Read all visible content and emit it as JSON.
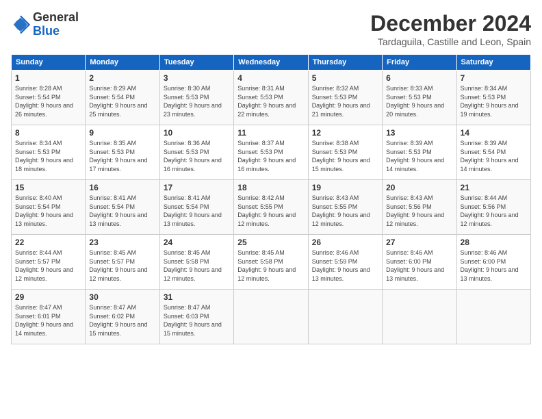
{
  "header": {
    "logo_line1": "General",
    "logo_line2": "Blue",
    "month_title": "December 2024",
    "location": "Tardaguila, Castille and Leon, Spain"
  },
  "weekdays": [
    "Sunday",
    "Monday",
    "Tuesday",
    "Wednesday",
    "Thursday",
    "Friday",
    "Saturday"
  ],
  "weeks": [
    [
      {
        "day": "1",
        "sunrise": "8:28 AM",
        "sunset": "5:54 PM",
        "daylight": "9 hours and 26 minutes."
      },
      {
        "day": "2",
        "sunrise": "8:29 AM",
        "sunset": "5:54 PM",
        "daylight": "9 hours and 25 minutes."
      },
      {
        "day": "3",
        "sunrise": "8:30 AM",
        "sunset": "5:53 PM",
        "daylight": "9 hours and 23 minutes."
      },
      {
        "day": "4",
        "sunrise": "8:31 AM",
        "sunset": "5:53 PM",
        "daylight": "9 hours and 22 minutes."
      },
      {
        "day": "5",
        "sunrise": "8:32 AM",
        "sunset": "5:53 PM",
        "daylight": "9 hours and 21 minutes."
      },
      {
        "day": "6",
        "sunrise": "8:33 AM",
        "sunset": "5:53 PM",
        "daylight": "9 hours and 20 minutes."
      },
      {
        "day": "7",
        "sunrise": "8:34 AM",
        "sunset": "5:53 PM",
        "daylight": "9 hours and 19 minutes."
      }
    ],
    [
      {
        "day": "8",
        "sunrise": "8:34 AM",
        "sunset": "5:53 PM",
        "daylight": "9 hours and 18 minutes."
      },
      {
        "day": "9",
        "sunrise": "8:35 AM",
        "sunset": "5:53 PM",
        "daylight": "9 hours and 17 minutes."
      },
      {
        "day": "10",
        "sunrise": "8:36 AM",
        "sunset": "5:53 PM",
        "daylight": "9 hours and 16 minutes."
      },
      {
        "day": "11",
        "sunrise": "8:37 AM",
        "sunset": "5:53 PM",
        "daylight": "9 hours and 16 minutes."
      },
      {
        "day": "12",
        "sunrise": "8:38 AM",
        "sunset": "5:53 PM",
        "daylight": "9 hours and 15 minutes."
      },
      {
        "day": "13",
        "sunrise": "8:39 AM",
        "sunset": "5:53 PM",
        "daylight": "9 hours and 14 minutes."
      },
      {
        "day": "14",
        "sunrise": "8:39 AM",
        "sunset": "5:54 PM",
        "daylight": "9 hours and 14 minutes."
      }
    ],
    [
      {
        "day": "15",
        "sunrise": "8:40 AM",
        "sunset": "5:54 PM",
        "daylight": "9 hours and 13 minutes."
      },
      {
        "day": "16",
        "sunrise": "8:41 AM",
        "sunset": "5:54 PM",
        "daylight": "9 hours and 13 minutes."
      },
      {
        "day": "17",
        "sunrise": "8:41 AM",
        "sunset": "5:54 PM",
        "daylight": "9 hours and 13 minutes."
      },
      {
        "day": "18",
        "sunrise": "8:42 AM",
        "sunset": "5:55 PM",
        "daylight": "9 hours and 12 minutes."
      },
      {
        "day": "19",
        "sunrise": "8:43 AM",
        "sunset": "5:55 PM",
        "daylight": "9 hours and 12 minutes."
      },
      {
        "day": "20",
        "sunrise": "8:43 AM",
        "sunset": "5:56 PM",
        "daylight": "9 hours and 12 minutes."
      },
      {
        "day": "21",
        "sunrise": "8:44 AM",
        "sunset": "5:56 PM",
        "daylight": "9 hours and 12 minutes."
      }
    ],
    [
      {
        "day": "22",
        "sunrise": "8:44 AM",
        "sunset": "5:57 PM",
        "daylight": "9 hours and 12 minutes."
      },
      {
        "day": "23",
        "sunrise": "8:45 AM",
        "sunset": "5:57 PM",
        "daylight": "9 hours and 12 minutes."
      },
      {
        "day": "24",
        "sunrise": "8:45 AM",
        "sunset": "5:58 PM",
        "daylight": "9 hours and 12 minutes."
      },
      {
        "day": "25",
        "sunrise": "8:45 AM",
        "sunset": "5:58 PM",
        "daylight": "9 hours and 12 minutes."
      },
      {
        "day": "26",
        "sunrise": "8:46 AM",
        "sunset": "5:59 PM",
        "daylight": "9 hours and 13 minutes."
      },
      {
        "day": "27",
        "sunrise": "8:46 AM",
        "sunset": "6:00 PM",
        "daylight": "9 hours and 13 minutes."
      },
      {
        "day": "28",
        "sunrise": "8:46 AM",
        "sunset": "6:00 PM",
        "daylight": "9 hours and 13 minutes."
      }
    ],
    [
      {
        "day": "29",
        "sunrise": "8:47 AM",
        "sunset": "6:01 PM",
        "daylight": "9 hours and 14 minutes."
      },
      {
        "day": "30",
        "sunrise": "8:47 AM",
        "sunset": "6:02 PM",
        "daylight": "9 hours and 15 minutes."
      },
      {
        "day": "31",
        "sunrise": "8:47 AM",
        "sunset": "6:03 PM",
        "daylight": "9 hours and 15 minutes."
      },
      null,
      null,
      null,
      null
    ]
  ]
}
